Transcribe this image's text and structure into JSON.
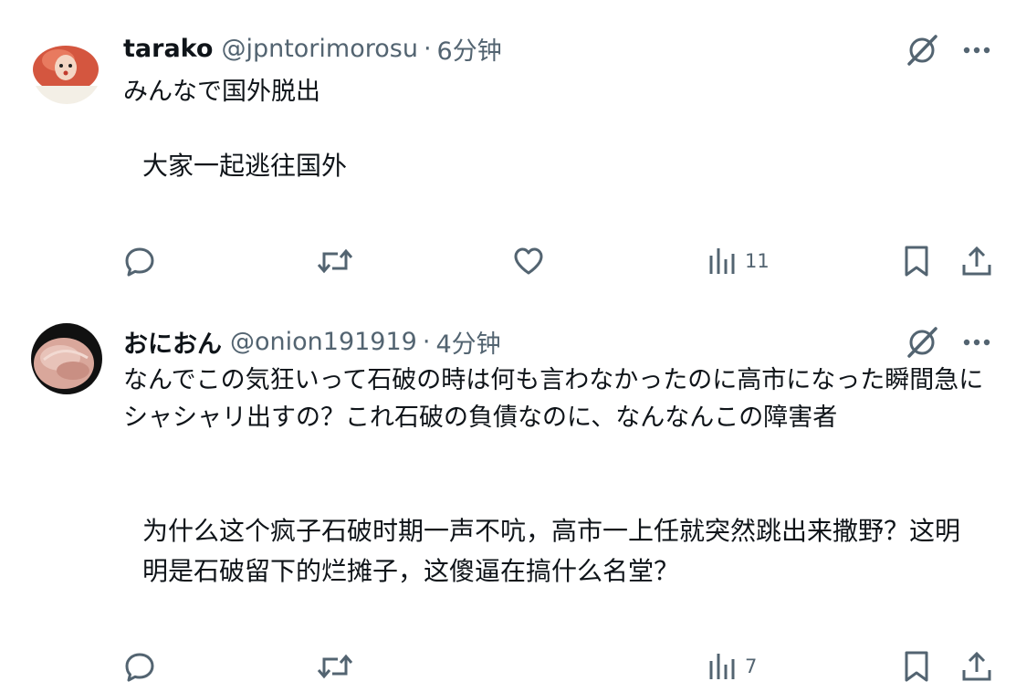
{
  "posts": [
    {
      "name": "tarako",
      "handle": "@jpntorimorosu",
      "dot": "·",
      "time": "6分钟",
      "original_text": "みんなで国外脱出",
      "translation": "大家一起逃往国外",
      "views": "11",
      "avatar_icon": "tarako-avatar"
    },
    {
      "name": "おにおん",
      "handle": "@onion191919",
      "dot": "·",
      "time": "4分钟",
      "original_text": "なんでこの気狂いって石破の時は何も言わなかったのに高市になった瞬間急にシャシャリ出すの？これ石破の負債なのに、なんなんこの障害者",
      "translation": "为什么这个疯子石破时期一声不吭，高市一上任就突然跳出来撒野？这明明是石破留下的烂摊子，这傻逼在搞什么名堂？",
      "views": "7",
      "avatar_icon": "onion-avatar"
    }
  ],
  "icons": [
    "grok-icon",
    "more-icon",
    "reply-icon",
    "repost-icon",
    "like-icon",
    "views-icon",
    "bookmark-icon",
    "share-icon"
  ],
  "colors": {
    "text": "#0f1419",
    "secondary": "#536471",
    "background": "#ffffff"
  }
}
